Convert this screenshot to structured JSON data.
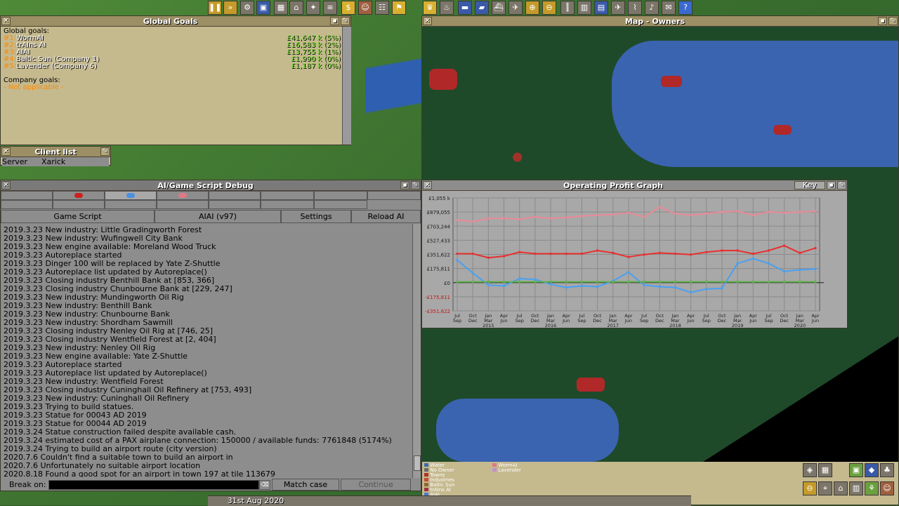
{
  "global_goals": {
    "title": "Global Goals",
    "heading": "Global goals:",
    "entries": [
      {
        "rank": "#1:",
        "name": "WormAI",
        "value": "£41,647 k (5%)"
      },
      {
        "rank": "#2:",
        "name": "trAIns AI",
        "value": "£16,583 k (2%)"
      },
      {
        "rank": "#3:",
        "name": "AIAI",
        "value": "£13,755 k (1%)"
      },
      {
        "rank": "#4:",
        "name": "Baltic Sun (Company 1)",
        "value": "£1,990 k (0%)"
      },
      {
        "rank": "#5:",
        "name": "Lavender (Company 6)",
        "value": "£1,187 k (0%)"
      }
    ],
    "company_heading": "Company goals:",
    "company_value": "- Not applicable -"
  },
  "client_list": {
    "title": "Client list",
    "role": "Server",
    "name": "Xarick"
  },
  "map_owners": {
    "title": "Map - Owners"
  },
  "debug": {
    "title": "AI/Game Script Debug",
    "company_colors": [
      "#cc2020",
      "#4a90e0",
      "#e07888"
    ],
    "buttons": {
      "game_script": "Game Script",
      "ai_name": "AIAI (v97)",
      "settings": "Settings",
      "reload": "Reload AI"
    },
    "log": [
      "2019.3.23 New industry: Little Gradingworth Forest",
      "2019.3.23 New industry: Wufingwell City Bank",
      "2019.3.23 New engine available: Moreland Wood Truck",
      "2019.3.23 Autoreplace started",
      "2019.3.23 Dinger 100 will be replaced by Yate Z-Shuttle",
      "2019.3.23 Autoreplace list updated by Autoreplace()",
      "2019.3.23 Closing industry Benthill Bank at [853, 366]",
      "2019.3.23 Closing industry Chunbourne Bank at [229, 247]",
      "2019.3.23 New industry: Mundingworth Oil Rig",
      "2019.3.23 New industry: Benthill Bank",
      "2019.3.23 New industry: Chunbourne Bank",
      "2019.3.23 New industry: Shordham Sawmill",
      "2019.3.23 Closing industry Nenley Oil Rig at [746, 25]",
      "2019.3.23 Closing industry Wentfield Forest at [2, 404]",
      "2019.3.23 New industry: Nenley Oil Rig",
      "2019.3.23 New engine available: Yate Z-Shuttle",
      "2019.3.23 Autoreplace started",
      "2019.3.23 Autoreplace list updated by Autoreplace()",
      "2019.3.23 New industry: Wentfield Forest",
      "2019.3.23 Closing industry Cuninghall Oil Refinery at [753, 493]",
      "2019.3.23 New industry: Cuninghall Oil Refinery",
      "2019.3.23 Trying to build statues.",
      "2019.3.23 Statue for 00043 AD 2019",
      "2019.3.23 Statue for 00044 AD 2019",
      "2019.3.24 Statue construction failed despite available cash.",
      "2019.3.24 estimated cost of a PAX airplane connection: 150000 / available funds: 7761848 (5174%)",
      "2019.3.24 Trying to build an airport route (city version)",
      "2020.7.6 Couldn't find a suitable town to build an airport in",
      "2020.7.6 Unfortunately no suitable airport location",
      "2020.8.18 Found a good spot for an airport in town 197 at tile 113679"
    ],
    "break_on_label": "Break on:",
    "match_case": "Match case",
    "continue": "Continue"
  },
  "graph": {
    "title": "Operating Profit Graph",
    "key_label": "Key"
  },
  "chart_data": {
    "type": "line",
    "title": "Operating Profit Graph",
    "y_ticks": [
      "£1,055 k",
      "£879,055",
      "£703,244",
      "£527,433",
      "£351,622",
      "£175,811",
      "£0",
      "-£175,811",
      "-£351,622"
    ],
    "ylim": [
      -351622,
      1055000
    ],
    "x_ticks": [
      {
        "top": "Jul",
        "bottom": "Sep",
        "year": ""
      },
      {
        "top": "Oct",
        "bottom": "Dec",
        "year": ""
      },
      {
        "top": "Jan",
        "bottom": "Mar",
        "year": "2015"
      },
      {
        "top": "Apr",
        "bottom": "Jun",
        "year": ""
      },
      {
        "top": "Jul",
        "bottom": "Sep",
        "year": ""
      },
      {
        "top": "Oct",
        "bottom": "Dec",
        "year": ""
      },
      {
        "top": "Jan",
        "bottom": "Mar",
        "year": "2016"
      },
      {
        "top": "Apr",
        "bottom": "Jun",
        "year": ""
      },
      {
        "top": "Jul",
        "bottom": "Sep",
        "year": ""
      },
      {
        "top": "Oct",
        "bottom": "Dec",
        "year": ""
      },
      {
        "top": "Jan",
        "bottom": "Mar",
        "year": "2017"
      },
      {
        "top": "Apr",
        "bottom": "Jun",
        "year": ""
      },
      {
        "top": "Jul",
        "bottom": "Sep",
        "year": ""
      },
      {
        "top": "Oct",
        "bottom": "Dec",
        "year": ""
      },
      {
        "top": "Jan",
        "bottom": "Mar",
        "year": "2018"
      },
      {
        "top": "Apr",
        "bottom": "Jun",
        "year": ""
      },
      {
        "top": "Jul",
        "bottom": "Sep",
        "year": ""
      },
      {
        "top": "Oct",
        "bottom": "Dec",
        "year": ""
      },
      {
        "top": "Jan",
        "bottom": "Mar",
        "year": "2019"
      },
      {
        "top": "Apr",
        "bottom": "Jun",
        "year": ""
      },
      {
        "top": "Jul",
        "bottom": "Sep",
        "year": ""
      },
      {
        "top": "Oct",
        "bottom": "Dec",
        "year": ""
      },
      {
        "top": "Jan",
        "bottom": "Mar",
        "year": "2020"
      },
      {
        "top": "Apr",
        "bottom": "Jun",
        "year": ""
      }
    ],
    "series": [
      {
        "color": "#e88a98",
        "values": [
          780000,
          760000,
          800000,
          800000,
          790000,
          820000,
          800000,
          810000,
          830000,
          840000,
          850000,
          870000,
          820000,
          940000,
          860000,
          840000,
          860000,
          880000,
          890000,
          840000,
          880000,
          870000,
          880000,
          890000
        ]
      },
      {
        "color": "#e83030",
        "values": [
          360000,
          360000,
          310000,
          330000,
          380000,
          360000,
          360000,
          360000,
          360000,
          400000,
          370000,
          320000,
          350000,
          370000,
          360000,
          350000,
          380000,
          400000,
          400000,
          360000,
          400000,
          460000,
          370000,
          430000
        ]
      },
      {
        "color": "#4aa0f0",
        "values": [
          280000,
          120000,
          -30000,
          -40000,
          50000,
          40000,
          -20000,
          -60000,
          -40000,
          -50000,
          20000,
          130000,
          -30000,
          -50000,
          -60000,
          -120000,
          -80000,
          -70000,
          240000,
          300000,
          240000,
          140000,
          160000,
          170000
        ]
      },
      {
        "color": "#5fb04a",
        "values": [
          10000,
          10000,
          10000,
          10000,
          10000,
          10000,
          10000,
          10000,
          10000,
          10000,
          10000,
          10000,
          10000,
          10000,
          10000,
          10000,
          10000,
          10000,
          10000,
          10000,
          10000,
          10000,
          10000,
          10000
        ]
      }
    ]
  },
  "legend_map": {
    "col1": [
      "Water",
      "No Owner",
      "Towns",
      "Industries",
      "Baltic Sun",
      "trAIns AI",
      "AIAI"
    ],
    "col2": [
      "WormAI",
      "Lavender"
    ],
    "colors1": [
      "#3a6ab0",
      "#6a6a6a",
      "#b03030",
      "#c84a30",
      "#8a6a30",
      "#a03040",
      "#4a7ad0"
    ],
    "colors2": [
      "#e07888",
      "#c090d0"
    ]
  },
  "status_bar": {
    "date": "31st Aug 2020"
  }
}
